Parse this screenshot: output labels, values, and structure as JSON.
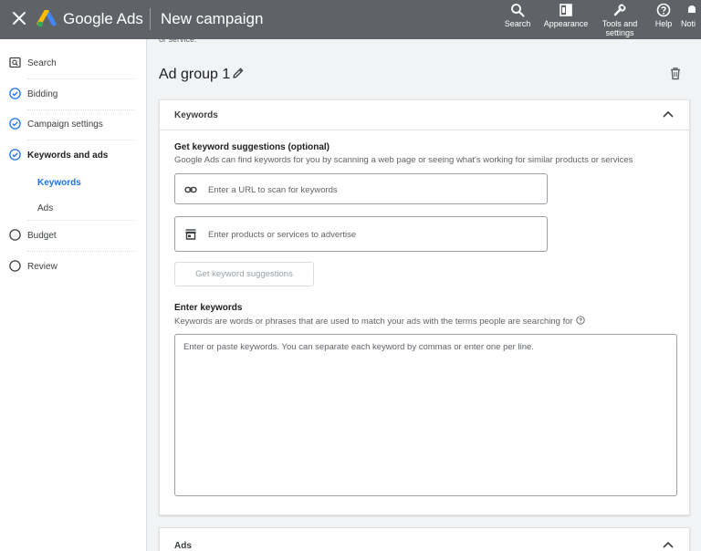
{
  "header": {
    "brand": "Google Ads",
    "page_title": "New campaign",
    "tools": [
      {
        "label": "Search",
        "icon": "search-icon"
      },
      {
        "label": "Appearance",
        "icon": "appearance-icon"
      },
      {
        "label": "Tools and\nsettings",
        "icon": "wrench-icon"
      },
      {
        "label": "Help",
        "icon": "help-icon"
      },
      {
        "label": "Noti",
        "icon": "bell-icon"
      }
    ]
  },
  "sidebar": {
    "items": [
      {
        "label": "Search",
        "icon": "search-campaign-icon"
      },
      {
        "label": "Bidding",
        "icon": "check-circle-icon"
      },
      {
        "label": "Campaign settings",
        "icon": "check-circle-icon"
      },
      {
        "label": "Keywords and ads",
        "icon": "check-circle-icon"
      },
      {
        "label": "Budget",
        "icon": "empty-circle-icon"
      },
      {
        "label": "Review",
        "icon": "empty-circle-icon"
      }
    ],
    "sub_items": [
      {
        "label": "Keywords"
      },
      {
        "label": "Ads"
      }
    ]
  },
  "main": {
    "cut_text": "or service.",
    "ad_group_title": "Ad group 1",
    "keywords_card": {
      "title": "Keywords",
      "suggestions_title": "Get keyword suggestions (optional)",
      "suggestions_desc": "Google Ads can find keywords for you by scanning a web page or seeing what's working for similar products or services",
      "url_placeholder": "Enter a URL to scan for keywords",
      "products_placeholder": "Enter products or services to advertise",
      "suggest_button": "Get keyword suggestions",
      "enter_title": "Enter keywords",
      "enter_desc": "Keywords are words or phrases that are used to match your ads with the terms people are searching for",
      "keywords_placeholder": "Enter or paste keywords. You can separate each keyword by commas or enter one per line."
    },
    "ads_card": {
      "title": "Ads"
    }
  },
  "colors": {
    "topbar": "#5f6368",
    "accent": "#1a73e8",
    "logo_blue": "#4285f4",
    "logo_yellow": "#fbbc04",
    "logo_green": "#34a853"
  }
}
